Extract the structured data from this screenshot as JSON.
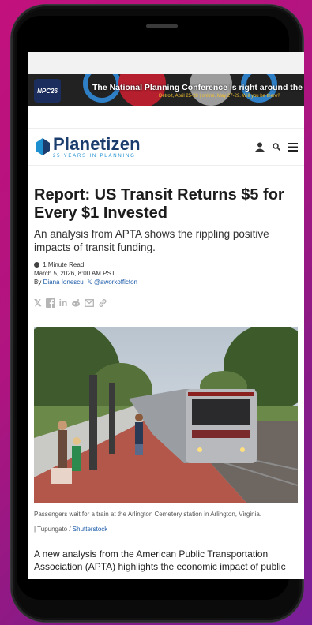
{
  "banner": {
    "logo_text": "NPC26",
    "headline": "The National Planning Conference is right around the corner.",
    "subline": "Detroit, April 25-28 | online, May 27-29. Will you be there?"
  },
  "site": {
    "name": "Planetizen",
    "tagline": "25 YEARS IN PLANNING"
  },
  "article": {
    "title": "Report: US Transit Returns $5 for Every $1 Invested",
    "summary": "An analysis from APTA shows the rippling positive impacts of transit funding.",
    "read_time": "1 Minute Read",
    "date": "March 5, 2026, 8:00 AM PST",
    "byline_prefix": "By",
    "author": "Diana Ionescu",
    "twitter_handle": "@aworkofficton",
    "image_caption": "Passengers wait for a train at the Arlington Cemetery station in Arlington, Virginia.",
    "credit_prefix": "| Tupungato /",
    "credit_source": "Shutterstock",
    "body_text": "A new analysis from the American Public Transportation Association (APTA) highlights the economic impact of public"
  },
  "share_icons": [
    "x-icon",
    "facebook-icon",
    "linkedin-icon",
    "reddit-icon",
    "email-icon",
    "link-icon"
  ],
  "colors": {
    "brand_navy": "#1b3d6e",
    "brand_blue": "#1e8fcf",
    "link_blue": "#1b5aa8",
    "background_magenta": "#c2117d"
  }
}
